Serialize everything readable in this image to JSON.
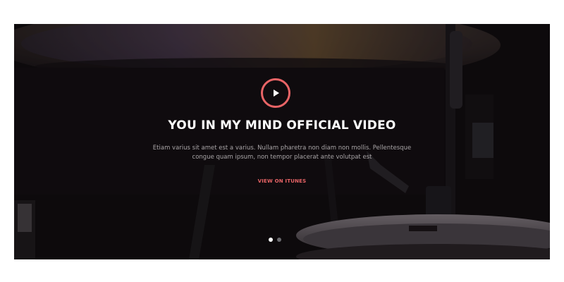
{
  "hero": {
    "title": "YOU IN MY MIND OFFICIAL VIDEO",
    "description": "Etiam varius sit amet est a varius. Nullam pharetra non diam non mollis. Pellentesque congue quam ipsum, non tempor placerat ante volutpat est",
    "link_label": "VIEW ON ITUNES",
    "accent_color": "#e86466",
    "play_icon": "play-icon"
  },
  "slider": {
    "total_slides": 2,
    "active_slide": 1
  }
}
